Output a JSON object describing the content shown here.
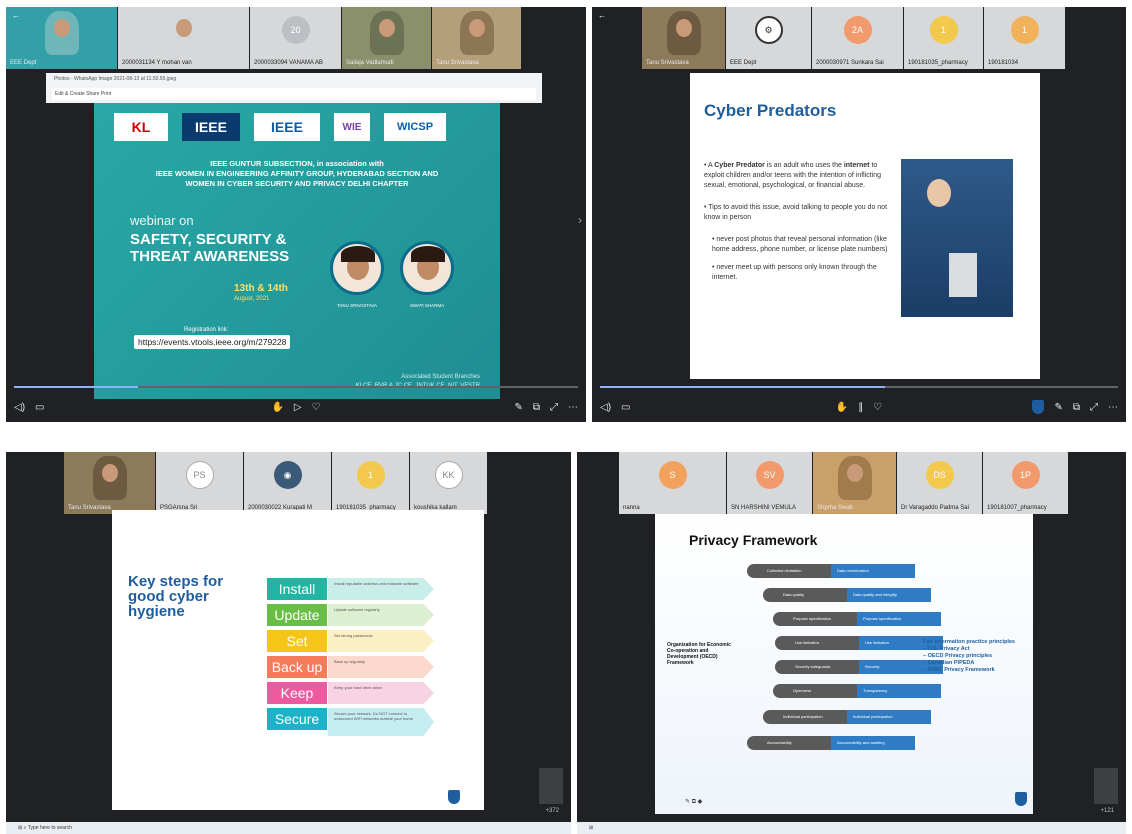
{
  "q1": {
    "tiles": [
      {
        "name": "EEE Dept",
        "initials": ""
      },
      {
        "name": "2000031134 Y mohan van",
        "initials": ""
      },
      {
        "name": "2000033094 VANAMA AB",
        "initials": "20"
      },
      {
        "name": "Sailaja Vadlamudi",
        "initials": ""
      },
      {
        "name": "Tanu Srivastava",
        "initials": ""
      }
    ],
    "window_title": "Photos - WhatsApp Image 2021-08-13 at 11.50.55.jpeg",
    "toolbar_text": "Edit & Create    Share    Print",
    "poster": {
      "line1": "IEEE GUNTUR SUBSECTION, in association with",
      "line2": "IEEE WOMEN IN ENGINEERING AFFINITY GROUP, HYDERABAD SECTION AND",
      "line3": "WOMEN IN CYBER SECURITY AND PRIVACY DELHI CHAPTER",
      "webinar_on": "webinar on",
      "webinar_title": "SAFETY, SECURITY & THREAT AWARENESS",
      "dates": "13th & 14th",
      "month": "August, 2021",
      "registration_label": "Registration link:",
      "url": "https://events.vtools.ieee.org/m/279228",
      "speaker1": "TANU SRIVASTAVA",
      "speaker2": "SWATI SHARMA",
      "footer1": "Associated Student Branches",
      "footer2": "KLCE, RVR & JC CE, JNTUK CE, NIT, VFSTR",
      "logos": [
        "KL",
        "IEEE",
        "IEEE",
        "WIE",
        "WICSP"
      ]
    }
  },
  "q2": {
    "tiles": [
      {
        "name": "Tanu Srivastava",
        "initials": ""
      },
      {
        "name": "EEE Dept",
        "initials": ""
      },
      {
        "name": "2000030971 Sunkara Sai",
        "initials": "2A"
      },
      {
        "name": "190181035_pharmacy",
        "initials": "1"
      },
      {
        "name": "190181034",
        "initials": "1"
      }
    ],
    "title": "Cyber Predators",
    "para1_a": "A ",
    "para1_b": "Cyber Predator",
    "para1_c": " is an adult who uses the ",
    "para1_d": "internet",
    "para1_e": " to exploit children and/or teens with the intention of inflicting sexual, emotional, psychological, or financial abuse.",
    "para2": "Tips to avoid this issue, avoid talking to people you do not know in person",
    "bullet1": "never post photos that reveal personal information (like home address, phone number, or license plate numbers)",
    "bullet2": "never meet up with persons only known through the internet."
  },
  "q3": {
    "tiles": [
      {
        "name": "Tanu Srivastava",
        "initials": ""
      },
      {
        "name": "PSGArsna Sri",
        "initials": "PS"
      },
      {
        "name": "2000030022 Kurapati  M",
        "initials": ""
      },
      {
        "name": "190181035_pharmacy",
        "initials": "1"
      },
      {
        "name": "koushika kallam",
        "initials": "KK"
      }
    ],
    "title": "Key steps for good cyber hygiene",
    "steps": [
      {
        "label": "Install",
        "desc": "Install reputable antivirus and malware software"
      },
      {
        "label": "Update",
        "desc": "Update software regularly"
      },
      {
        "label": "Set",
        "desc": "Set strong passwords"
      },
      {
        "label": "Back up",
        "desc": "Back up regularly"
      },
      {
        "label": "Keep",
        "desc": "Keep your hard drive clean"
      },
      {
        "label": "Secure",
        "desc": "Secure your network. Do NOT connect to unsecured WiFi networks outside your home"
      }
    ],
    "taskbar_search": "Type here to search",
    "counter": "+372"
  },
  "q4": {
    "tiles": [
      {
        "name": "nanna",
        "initials": "S"
      },
      {
        "name": "SN HARSHINI VEMULA",
        "initials": "SV"
      },
      {
        "name": "Shprha  Swati",
        "initials": ""
      },
      {
        "name": "Dr Varagaddo Padma Sai",
        "initials": "DS"
      },
      {
        "name": "190181007_pharmacy",
        "initials": "1P"
      }
    ],
    "title": "Privacy Framework",
    "rows": [
      {
        "left": "Collection limitation",
        "right": "Data minimization"
      },
      {
        "left": "Data quality",
        "right": "Data quality and integrity"
      },
      {
        "left": "Purpose specification",
        "right": "Purpose specification"
      },
      {
        "left": "Use limitation",
        "right": "Use limitation"
      },
      {
        "left": "Security safeguards",
        "right": "Security"
      },
      {
        "left": "Openness",
        "right": "Transparency"
      },
      {
        "left": "Individual participation",
        "right": "Individual participation"
      },
      {
        "left": "Accountability",
        "right": "Accountability and auditing"
      }
    ],
    "org": "Organization for Economic Co-operation and Development (OECD) Framework",
    "fip_title": "Fair information practice principles",
    "fip_items": [
      "– U.S. Privacy Act",
      "– OECD Privacy principles",
      "– Canadian PIPEDA",
      "– APEC Privacy Framework"
    ],
    "counter": "+121"
  }
}
